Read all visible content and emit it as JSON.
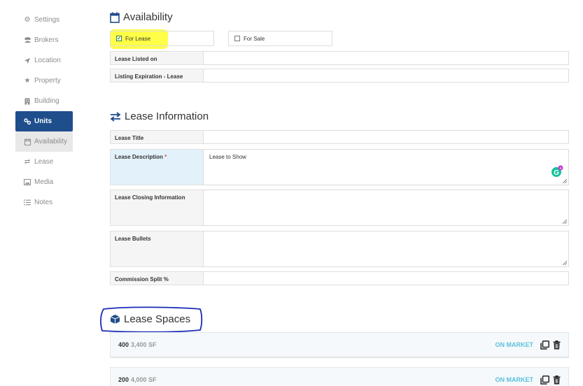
{
  "sidebar": {
    "items": [
      {
        "label": "Settings",
        "icon": "gear-icon"
      },
      {
        "label": "Brokers",
        "icon": "users-icon"
      },
      {
        "label": "Location",
        "icon": "location-arrow-icon"
      },
      {
        "label": "Property",
        "icon": "star-icon"
      },
      {
        "label": "Building",
        "icon": "building-icon"
      },
      {
        "label": "Units",
        "icon": "units-icon"
      },
      {
        "label": "Availability",
        "icon": "calendar-icon"
      },
      {
        "label": "Lease",
        "icon": "exchange-icon"
      },
      {
        "label": "Media",
        "icon": "image-icon"
      },
      {
        "label": "Notes",
        "icon": "list-icon"
      }
    ]
  },
  "availability": {
    "title": "Availability",
    "for_lease": {
      "label": "For Lease",
      "checked": true
    },
    "for_sale": {
      "label": "For Sale",
      "checked": false
    },
    "lease_listed_on": {
      "label": "Lease Listed on",
      "value": ""
    },
    "listing_expiration": {
      "label": "Listing Expiration - Lease",
      "value": ""
    }
  },
  "lease_info": {
    "title": "Lease Information",
    "lease_title": {
      "label": "Lease Title",
      "value": ""
    },
    "lease_description": {
      "label": "Lease Description",
      "required": "*",
      "value": "Lease to Show"
    },
    "closing_info": {
      "label": "Lease Closing Information",
      "value": ""
    },
    "bullets": {
      "label": "Lease Bullets",
      "value": ""
    },
    "commission": {
      "label": "Commission Split %",
      "value": ""
    }
  },
  "lease_spaces": {
    "title": "Lease Spaces",
    "items": [
      {
        "number": "400",
        "size": "3,400 SF",
        "status": "ON MARKET"
      },
      {
        "number": "200",
        "size": "4,000 SF",
        "status": "ON MARKET"
      }
    ]
  },
  "colors": {
    "accent": "#1f4e8c",
    "status": "#5bc0de",
    "highlight": "#ffff3d",
    "annotation": "#1a2bb8"
  }
}
